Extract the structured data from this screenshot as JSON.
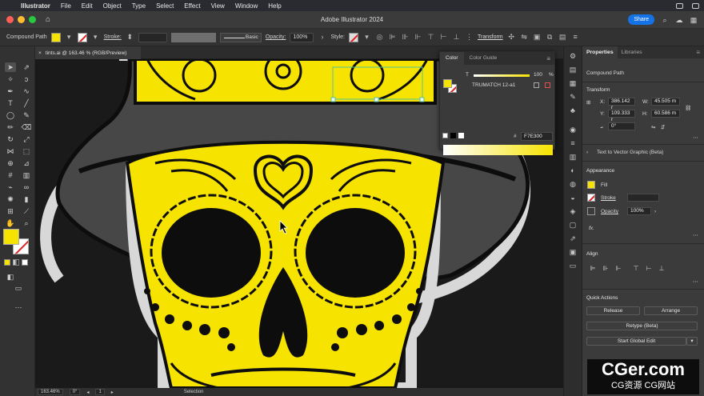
{
  "menubar": {
    "app": "Illustrator",
    "items": [
      "File",
      "Edit",
      "Object",
      "Type",
      "Select",
      "Effect",
      "View",
      "Window",
      "Help"
    ]
  },
  "appbar": {
    "title": "Adobe Illustrator 2024",
    "share": "Share"
  },
  "controlbar": {
    "selection": "Compound Path",
    "stroke_label": "Stroke:",
    "brush": "Basic",
    "opacity_label": "Opacity:",
    "opacity": "100%",
    "style_label": "Style:",
    "transform": "Transform"
  },
  "document": {
    "tab": "tints.ai @ 163.46 % (RGB/Preview)",
    "zoom": "163.46%",
    "rotation": "0°",
    "artboard": "1",
    "mode": "Selection"
  },
  "color_panel": {
    "tabs": [
      "Color",
      "Color Guide"
    ],
    "tint_label": "T",
    "tint": "100",
    "pct": "%",
    "swatch_name": "TRUMATCH 12-a1",
    "hash": "#",
    "hex": "F7E300"
  },
  "properties": {
    "tabs": [
      "Properties",
      "Libraries"
    ],
    "object": "Compound Path",
    "transform_title": "Transform",
    "x_label": "X:",
    "x": "386.142 r",
    "y_label": "Y:",
    "y": "109.333 r",
    "w_label": "W:",
    "w": "45.505 m",
    "h_label": "H:",
    "h": "60.586 m",
    "rotate": "0°",
    "text_to_vector": "Text to Vector Graphic (Beta)",
    "appearance_title": "Appearance",
    "fill_label": "Fill",
    "stroke_label": "Stroke",
    "opacity_label": "Opacity",
    "opacity": "100%",
    "fx": "fx.",
    "align_title": "Align",
    "quick_actions_title": "Quick Actions",
    "release": "Release",
    "arrange": "Arrange",
    "retype": "Retype (Beta)",
    "start_global_edit": "Start Global Edit"
  },
  "watermark": {
    "big": "CGer.com",
    "small": "CG资源 CG网站"
  },
  "colors": {
    "fill": "#f7e300",
    "accent": "#1473e6"
  }
}
